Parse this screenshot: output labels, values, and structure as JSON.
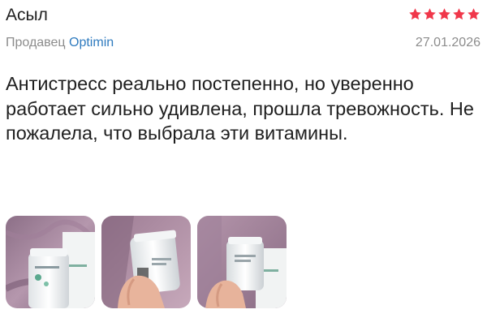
{
  "review": {
    "author": "Асыл",
    "rating": 5,
    "max_rating": 5,
    "star_color": "#f0374a",
    "seller_prefix": "Продавец",
    "seller_name": "Optimin",
    "date": "27.01.2026",
    "text": "Антистресс реально постепенно, но уверенно работает сильно удивлена, прошла тревожность. Не пожалела, что выбрала эти витамины."
  },
  "photos": [
    {
      "name": "photo-1",
      "scene": "bottle-on-purple-fabric"
    },
    {
      "name": "photo-2",
      "scene": "bottle-in-hand"
    },
    {
      "name": "photo-3",
      "scene": "bottle-and-box-in-hand"
    }
  ],
  "colors": {
    "text": "#1f1f1f",
    "muted": "#8c8c8c",
    "link": "#2f7bbf"
  }
}
